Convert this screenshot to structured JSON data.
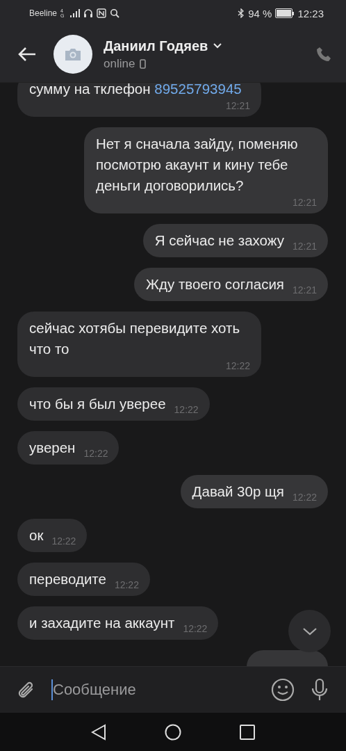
{
  "status_bar": {
    "carrier": "Beeline",
    "network": "4G",
    "battery": "94 %",
    "time": "12:23"
  },
  "header": {
    "name": "Даниил Годяев",
    "status": "online"
  },
  "messages": [
    {
      "kind": "incoming",
      "text": "сумму на тклефон ",
      "link": "89525793945",
      "time": "12:21"
    },
    {
      "kind": "outgoing",
      "text": "Нет я сначала зайду, поменяю посмотрю акаунт и кину тебе деньги договорились?",
      "time": "12:21"
    },
    {
      "kind": "outgoing",
      "text": "Я сейчас не захожу",
      "time": "12:21"
    },
    {
      "kind": "outgoing",
      "text": "Жду твоего согласия",
      "time": "12:21"
    },
    {
      "kind": "incoming",
      "text": "сейчас хотябы перевидите хоть что то",
      "time": "12:22"
    },
    {
      "kind": "incoming",
      "text": "что бы я был уверее",
      "time": "12:22"
    },
    {
      "kind": "incoming",
      "text": "уверен",
      "time": "12:22"
    },
    {
      "kind": "outgoing",
      "text": "Давай 30р щя",
      "time": "12:22"
    },
    {
      "kind": "incoming",
      "text": "ок",
      "time": "12:22"
    },
    {
      "kind": "incoming",
      "text": "переводите",
      "time": "12:22"
    },
    {
      "kind": "incoming",
      "text": "и захадите на аккаунт",
      "time": "12:22"
    }
  ],
  "composer": {
    "placeholder": "Сообщение"
  }
}
